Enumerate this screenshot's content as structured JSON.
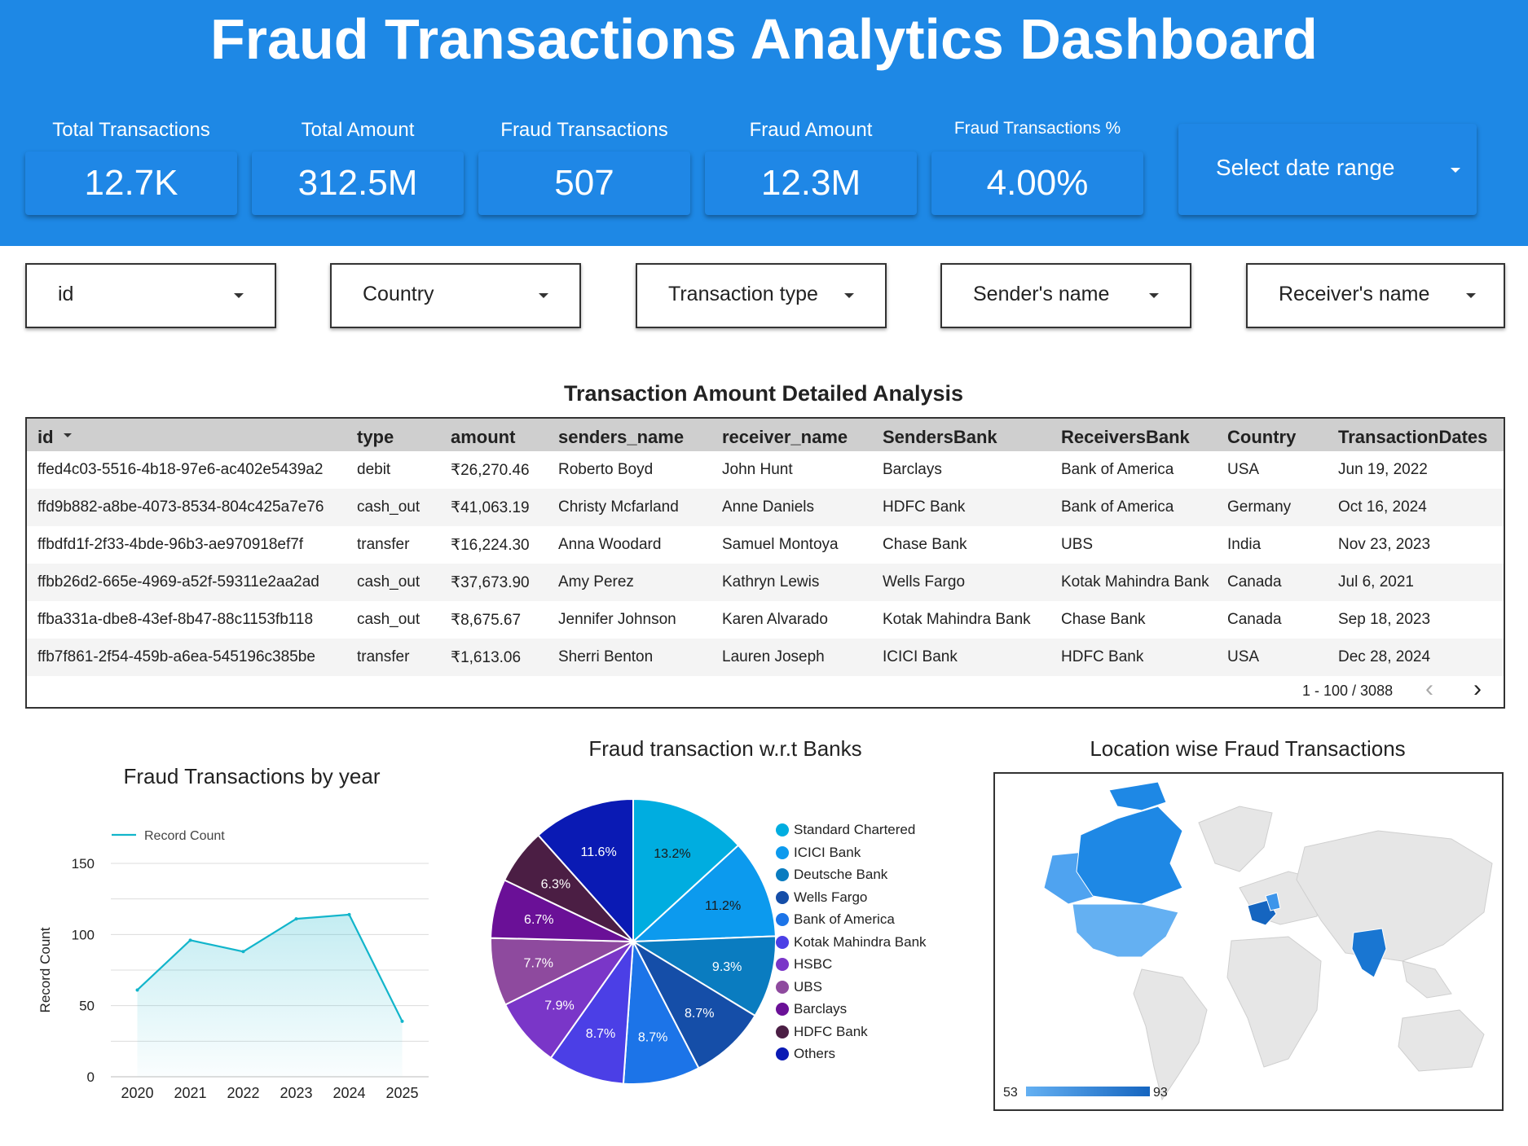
{
  "header": {
    "title": "Fraud Transactions Analytics Dashboard"
  },
  "kpis": [
    {
      "label": "Total Transactions",
      "value": "12.7K"
    },
    {
      "label": "Total Amount",
      "value": "312.5M"
    },
    {
      "label": "Fraud Transactions",
      "value": "507"
    },
    {
      "label": "Fraud Amount",
      "value": "12.3M"
    },
    {
      "label": "Fraud Transactions %",
      "value": "4.00%"
    }
  ],
  "date_range": {
    "label": "Select date range"
  },
  "filters": [
    "id",
    "Country",
    "Transaction type",
    "Sender's name",
    "Receiver's name"
  ],
  "table": {
    "title": "Transaction Amount Detailed Analysis",
    "sort_icon": "sort-desc-icon",
    "columns": [
      "id",
      "type",
      "amount",
      "senders_name",
      "receiver_name",
      "SendersBank",
      "ReceiversBank",
      "Country",
      "TransactionDates"
    ],
    "rows": [
      [
        "ffed4c03-5516-4b18-97e6-ac402e5439a2",
        "debit",
        "₹26,270.46",
        "Roberto Boyd",
        "John Hunt",
        "Barclays",
        "Bank of America",
        "USA",
        "Jun 19, 2022"
      ],
      [
        "ffd9b882-a8be-4073-8534-804c425a7e76",
        "cash_out",
        "₹41,063.19",
        "Christy Mcfarland",
        "Anne Daniels",
        "HDFC Bank",
        "Bank of America",
        "Germany",
        "Oct 16, 2024"
      ],
      [
        "ffbdfd1f-2f33-4bde-96b3-ae970918ef7f",
        "transfer",
        "₹16,224.30",
        "Anna Woodard",
        "Samuel Montoya",
        "Chase Bank",
        "UBS",
        "India",
        "Nov 23, 2023"
      ],
      [
        "ffbb26d2-665e-4969-a52f-59311e2aa2ad",
        "cash_out",
        "₹37,673.90",
        "Amy Perez",
        "Kathryn Lewis",
        "Wells Fargo",
        "Kotak Mahindra Bank",
        "Canada",
        "Jul 6, 2021"
      ],
      [
        "ffba331a-dbe8-43ef-8b47-88c1153fb118",
        "cash_out",
        "₹8,675.67",
        "Jennifer Johnson",
        "Karen Alvarado",
        "Kotak Mahindra Bank",
        "Chase Bank",
        "Canada",
        "Sep 18, 2023"
      ],
      [
        "ffb7f861-2f54-459b-a6ea-545196c385be",
        "transfer",
        "₹1,613.06",
        "Sherri Benton",
        "Lauren Joseph",
        "ICICI Bank",
        "HDFC Bank",
        "USA",
        "Dec 28, 2024"
      ]
    ],
    "pagination": "1 - 100 / 3088"
  },
  "map": {
    "title": "Location wise Fraud Transactions",
    "scale_min": "53",
    "scale_max": "93"
  },
  "chart_data": [
    {
      "type": "area",
      "title": "Fraud Transactions by year",
      "x": [
        "2020",
        "2021",
        "2022",
        "2023",
        "2024",
        "2025"
      ],
      "series": [
        {
          "name": "Record Count",
          "values": [
            61,
            96,
            88,
            111,
            114,
            39
          ]
        }
      ],
      "ylabel": "Record Count",
      "xlabel": "",
      "ylim": [
        0,
        150
      ],
      "yticks": [
        0,
        50,
        100,
        150
      ],
      "grid": true,
      "legend": "top-left",
      "color": "#12b5cb"
    },
    {
      "type": "pie",
      "title": "Fraud transaction w.r.t Banks",
      "legend": "right",
      "slices": [
        {
          "label": "Standard Chartered",
          "value": 13.2,
          "text": "13.2%",
          "color": "#00ade0"
        },
        {
          "label": "ICICI Bank",
          "value": 11.2,
          "text": "11.2%",
          "color": "#0c9aee"
        },
        {
          "label": "Deutsche Bank",
          "value": 9.3,
          "text": "9.3%",
          "color": "#0a7cc0"
        },
        {
          "label": "Wells Fargo",
          "value": 8.7,
          "text": "8.7%",
          "color": "#154ea8"
        },
        {
          "label": "Bank of America",
          "value": 8.7,
          "text": "8.7%",
          "color": "#1c74e8"
        },
        {
          "label": "Kotak Mahindra Bank",
          "value": 8.7,
          "text": "8.7%",
          "color": "#4b3fe6"
        },
        {
          "label": "HSBC",
          "value": 7.9,
          "text": "7.9%",
          "color": "#7a36c8"
        },
        {
          "label": "UBS",
          "value": 7.7,
          "text": "7.7%",
          "color": "#8e4a9e"
        },
        {
          "label": "Barclays",
          "value": 6.7,
          "text": "6.7%",
          "color": "#6a1097"
        },
        {
          "label": "HDFC Bank",
          "value": 6.3,
          "text": "6.3%",
          "color": "#4b1e44"
        },
        {
          "label": "Others",
          "value": 11.6,
          "text": "11.6%",
          "color": "#0a1ab4"
        }
      ]
    }
  ]
}
